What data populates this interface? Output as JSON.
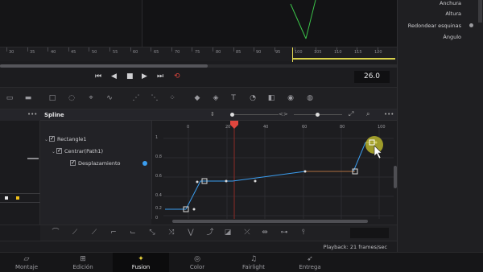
{
  "ruler": {
    "ticks": [
      "30",
      "35",
      "40",
      "45",
      "50",
      "55",
      "60",
      "65",
      "70",
      "75",
      "80",
      "85",
      "90",
      "95",
      "100",
      "105",
      "110",
      "115",
      "120"
    ]
  },
  "transport": {
    "timecode": "26.0"
  },
  "spline": {
    "title": "Spline",
    "dots": "•••"
  },
  "tree": {
    "items": [
      "Rectangle1",
      "Centrar(Path1)",
      "Desplazamiento"
    ]
  },
  "graph": {
    "xticks": [
      "0",
      "20",
      "40",
      "60",
      "80",
      "100"
    ],
    "yticks": [
      "1",
      "0.8",
      "0.6",
      "0.4",
      "0.2",
      "0"
    ],
    "playhead_frame": 26
  },
  "inspector": {
    "props": [
      "Anchura",
      "Altura",
      "Redondear esquinas",
      "Ángulo"
    ]
  },
  "status": {
    "playback": "Playback: 21 frames/sec"
  },
  "pages": [
    "Montaje",
    "Edición",
    "Fusion",
    "Color",
    "Fairlight",
    "Entrega"
  ],
  "active_page": "Fusion",
  "colors": {
    "accent_red": "#e0463e",
    "curve_blue": "#3b9ef0",
    "highlight_yellow": "#d6d23c"
  }
}
